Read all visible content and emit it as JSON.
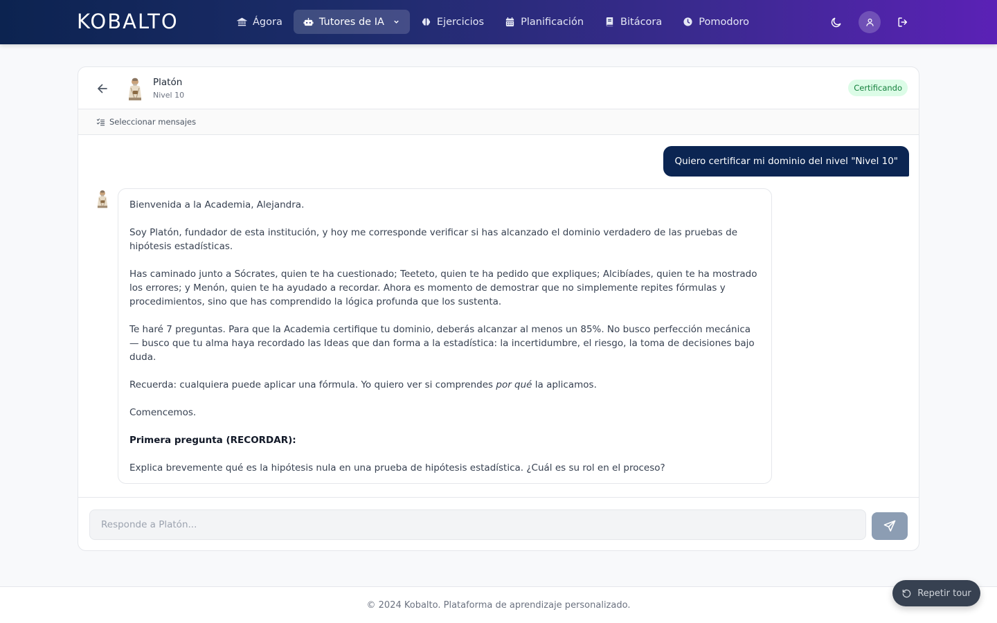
{
  "app": {
    "brand": "KOBALTO"
  },
  "nav": {
    "items": [
      {
        "label": "Ágora",
        "icon": "landmark-icon"
      },
      {
        "label": "Tutores de IA",
        "icon": "bot-icon",
        "active": true
      },
      {
        "label": "Ejercicios",
        "icon": "brain-icon"
      },
      {
        "label": "Planificación",
        "icon": "calendar-icon"
      },
      {
        "label": "Bitácora",
        "icon": "notebook-icon"
      },
      {
        "label": "Pomodoro",
        "icon": "clock-icon"
      }
    ]
  },
  "chat": {
    "tutor_name": "Platón",
    "tutor_level": "Nivel 10",
    "status_badge": "Certificando",
    "select_messages": "Seleccionar mensajes",
    "user_message": "Quiero certificar mi dominio del nivel \"Nivel 10\"",
    "bot_message": {
      "p1": "Bienvenida a la Academia, Alejandra.",
      "p2": "Soy Platón, fundador de esta institución, y hoy me corresponde verificar si has alcanzado el dominio verdadero de las pruebas de hipótesis estadísticas.",
      "p3": "Has caminado junto a Sócrates, quien te ha cuestionado; Teeteto, quien te ha pedido que expliques; Alcibíades, quien te ha mostrado los errores; y Menón, quien te ha ayudado a recordar. Ahora es momento de demostrar que no simplemente repites fórmulas y procedimientos, sino que has comprendido la lógica profunda que los sustenta.",
      "p4": "Te haré 7 preguntas. Para que la Academia certifique tu dominio, deberás alcanzar al menos un 85%. No busco perfección mecánica — busco que tu alma haya recordado las Ideas que dan forma a la estadística: la incertidumbre, el riesgo, la toma de decisiones bajo duda.",
      "p5_before": "Recuerda: cualquiera puede aplicar una fórmula. Yo quiero ver si comprendes ",
      "p5_em": "por qué",
      "p5_after": " la aplicamos.",
      "p6": "Comencemos.",
      "p7": "Primera pregunta (RECORDAR):",
      "p8": "Explica brevemente qué es la hipótesis nula en una prueba de hipótesis estadística. ¿Cuál es su rol en el proceso?"
    },
    "input_placeholder": "Responde a Platón...",
    "input_value": ""
  },
  "footer": {
    "text": "© 2024 Kobalto. Plataforma de aprendizaje personalizado.",
    "tour_button": "Repetir tour"
  },
  "colors": {
    "nav_gradient_start": "#0c2350",
    "nav_gradient_end": "#5b21b6",
    "user_bubble": "#0b2552",
    "badge_bg": "#dcfce7",
    "badge_text": "#15803d",
    "send_button": "#8c9db3"
  }
}
